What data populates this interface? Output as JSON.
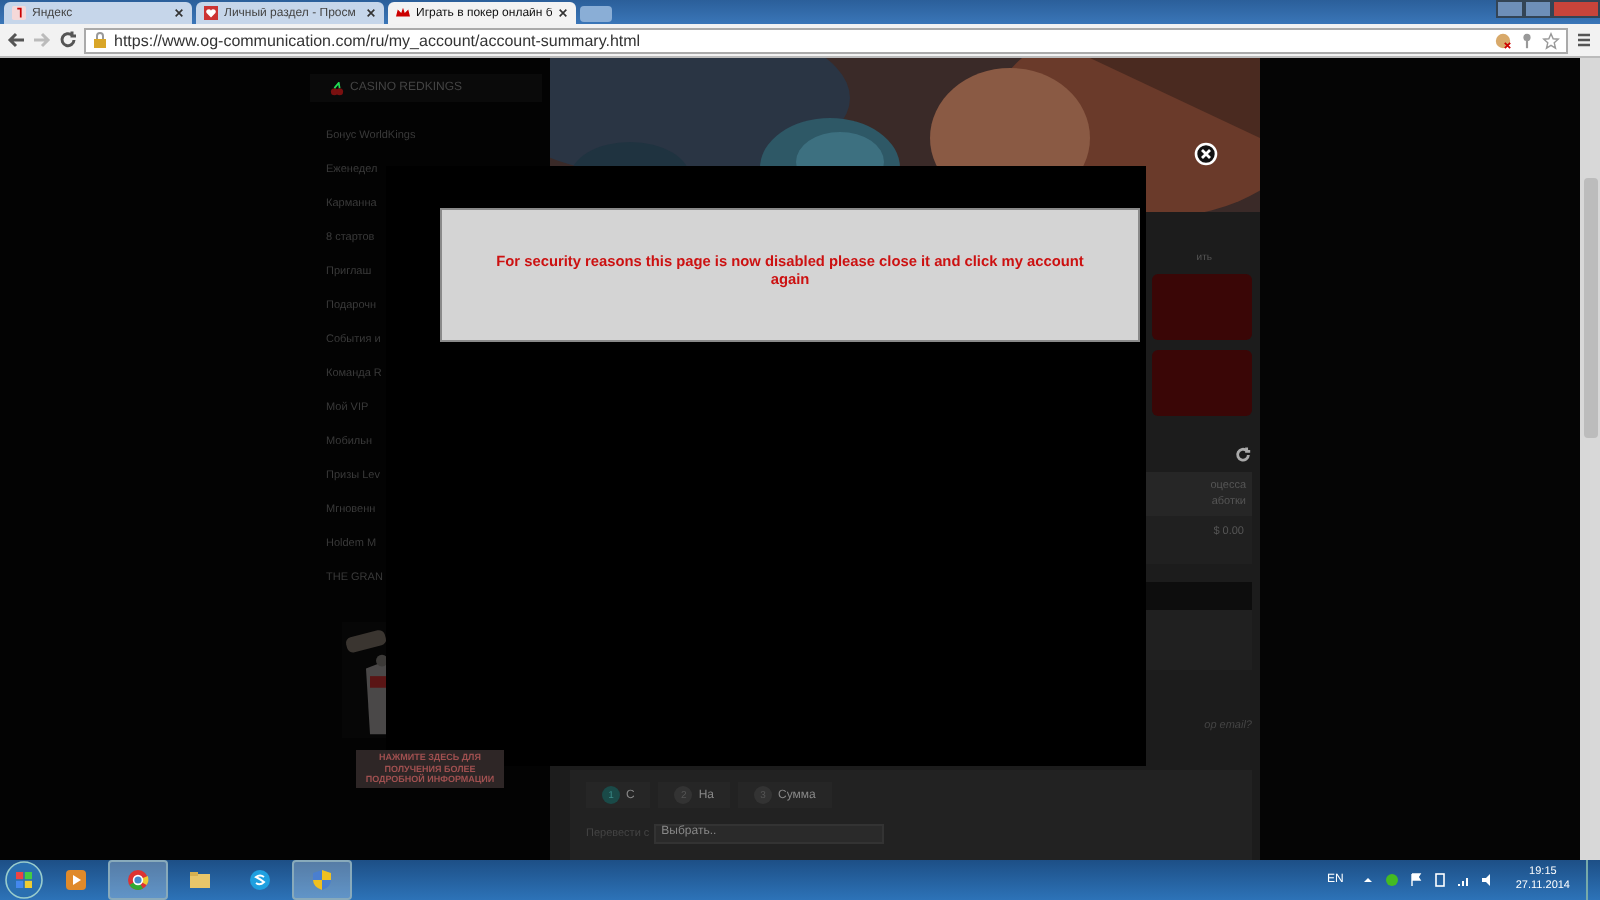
{
  "browser": {
    "tabs": [
      {
        "title": "Яндекс",
        "selected": false
      },
      {
        "title": "Личный раздел - Просм",
        "selected": false
      },
      {
        "title": "Играть в покер онлайн б",
        "selected": true
      }
    ],
    "url": "https://www.og-communication.com/ru/my_account/account-summary.html"
  },
  "sidebar": {
    "heading": "CASINO REDKINGS",
    "items": [
      "Бонус WorldKings",
      "Еженедел",
      "Карманна",
      "8 стартов",
      "Приглаш",
      "Подарочн",
      "События и",
      "Команда R",
      "Мой VIP",
      "Мобильн",
      "Призы Lev",
      "Мгновенн",
      "Holdem M",
      "THE GRAN"
    ],
    "banner_text": "НАЖМИТЕ ЗДЕСЬ ДЛЯ ПОЛУЧЕНИЯ БОЛЕЕ ПОДРОБНОЙ ИНФОРМАЦИИ"
  },
  "account": {
    "partial_label": "ить",
    "table_header": [
      "оцесса",
      "аботки"
    ],
    "balance": "$ 0.00",
    "email_text": "ор email?",
    "steps": [
      {
        "number": "1",
        "label": "С",
        "selected": true
      },
      {
        "number": "2",
        "label": "На",
        "selected": false
      },
      {
        "number": "3",
        "label": "Сумма",
        "selected": false
      }
    ],
    "transfer_label": "Перевести с",
    "transfer_select": "Выбрать.."
  },
  "modal": {
    "message": "For security reasons this page is now disabled please close it and click my account again"
  },
  "taskbar": {
    "language": "EN",
    "time": "19:15",
    "date": "27.11.2014"
  }
}
